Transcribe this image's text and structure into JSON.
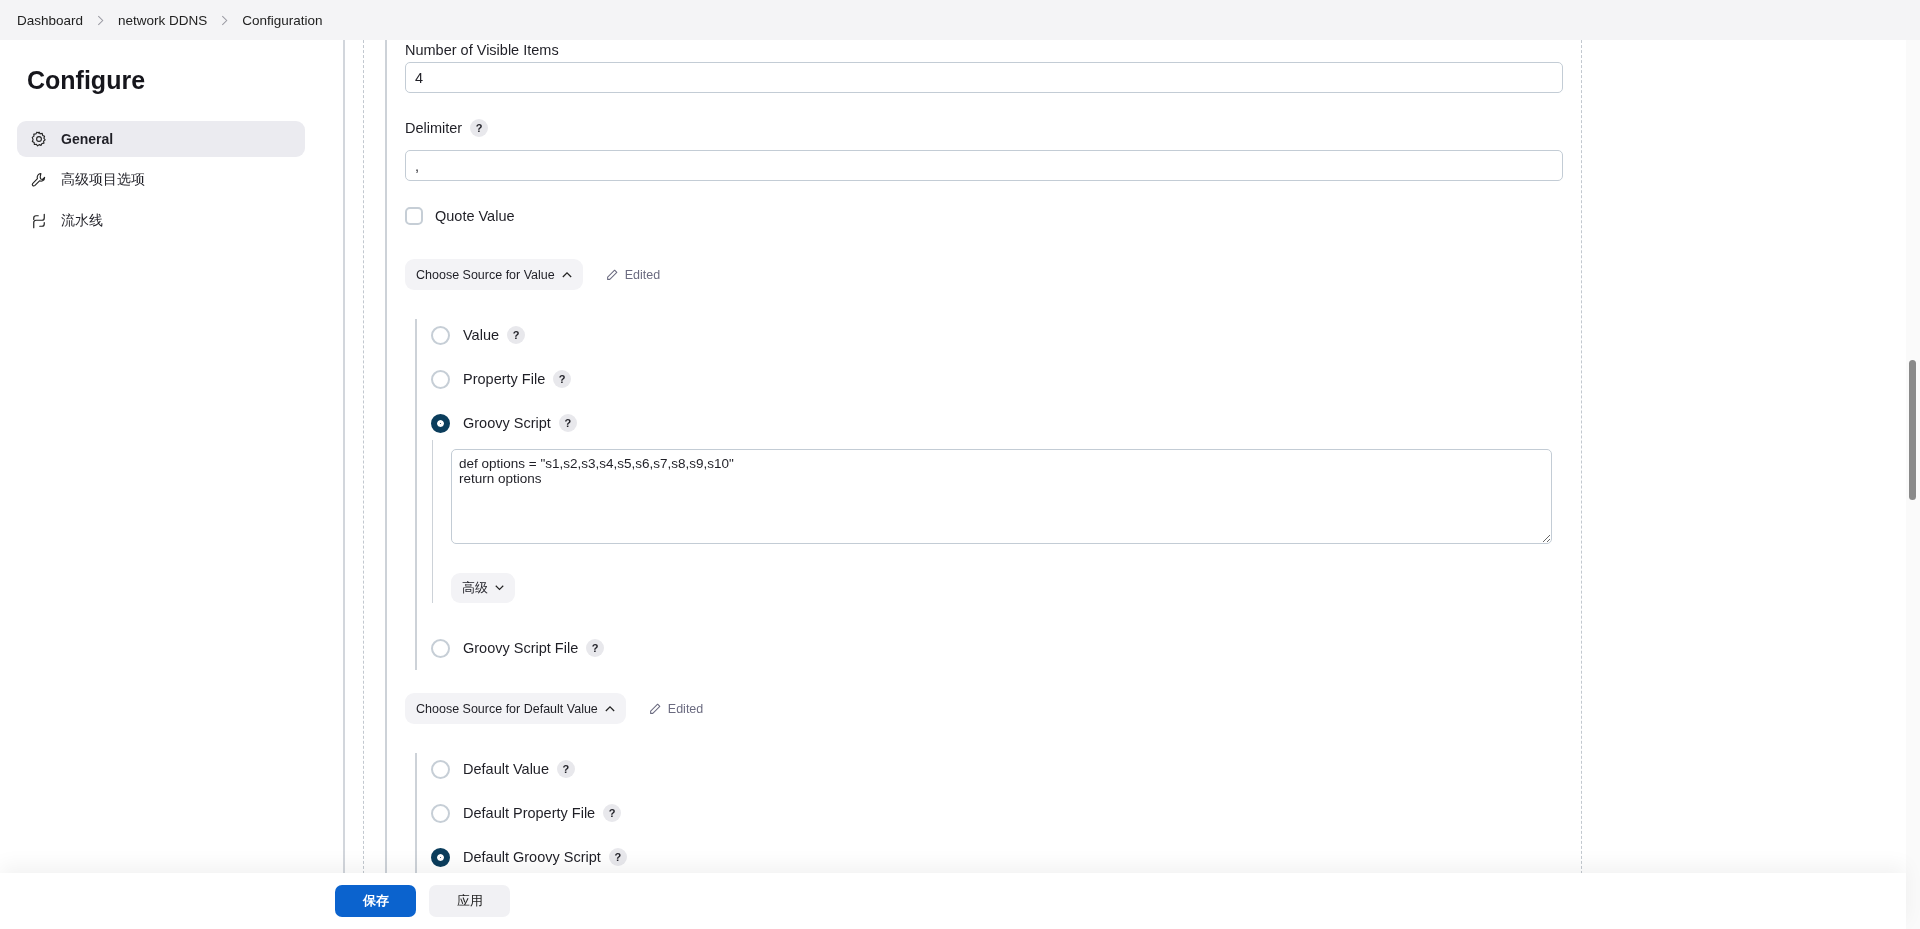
{
  "breadcrumb": [
    {
      "label": "Dashboard"
    },
    {
      "label": "network DDNS"
    },
    {
      "label": "Configuration"
    }
  ],
  "sidebar": {
    "title": "Configure",
    "items": [
      {
        "label": "General",
        "selected": true
      },
      {
        "label": "高级项目选项",
        "selected": false
      },
      {
        "label": "流水线",
        "selected": false
      }
    ]
  },
  "form": {
    "visible_items": {
      "label": "Number of Visible Items",
      "value": "4"
    },
    "delimiter": {
      "label": "Delimiter",
      "help": "?",
      "value": ","
    },
    "quote_value": {
      "label": "Quote Value",
      "checked": false
    },
    "sources": [
      {
        "label": "Choose Source for Value",
        "expanded": true,
        "status": "Edited",
        "options": [
          {
            "label": "Value",
            "help": "?",
            "selected": false
          },
          {
            "label": "Property File",
            "help": "?",
            "selected": false
          },
          {
            "label": "Groovy Script",
            "help": "?",
            "selected": true,
            "script": "def options = \"s1,s2,s3,s4,s5,s6,s7,s8,s9,s10\"\nreturn options",
            "advanced": {
              "label": "高级",
              "expanded": false
            }
          },
          {
            "label": "Groovy Script File",
            "help": "?",
            "selected": false
          }
        ]
      },
      {
        "label": "Choose Source for Default Value",
        "expanded": true,
        "status": "Edited",
        "options": [
          {
            "label": "Default Value",
            "help": "?",
            "selected": false
          },
          {
            "label": "Default Property File",
            "help": "?",
            "selected": false
          },
          {
            "label": "Default Groovy Script",
            "help": "?",
            "selected": true
          }
        ]
      }
    ]
  },
  "actions": [
    {
      "label": "保存",
      "kind": "primary"
    },
    {
      "label": "应用",
      "kind": "secondary"
    }
  ]
}
